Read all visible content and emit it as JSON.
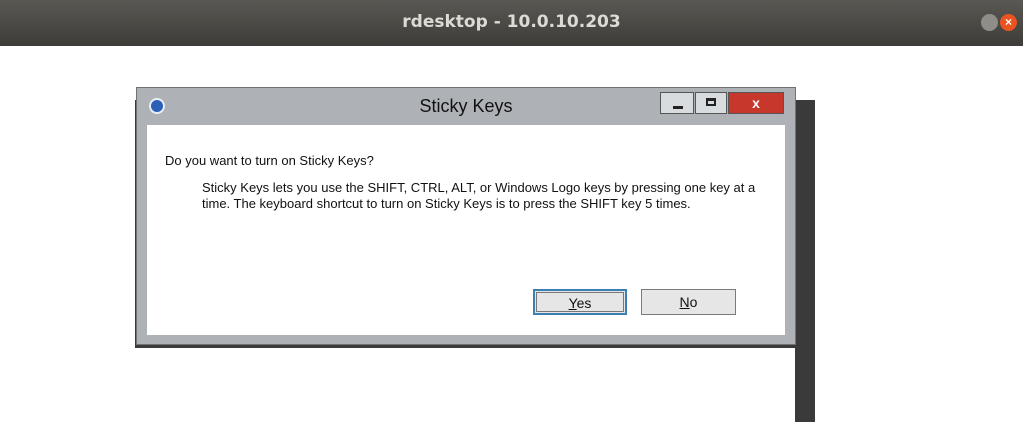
{
  "window": {
    "title": "rdesktop - 10.0.10.203",
    "close_glyph": "×"
  },
  "dialog": {
    "title": "Sticky Keys",
    "close_glyph": "x",
    "question": "Do you want to turn on Sticky Keys?",
    "description": "Sticky Keys lets you use the SHIFT, CTRL, ALT, or Windows Logo keys by pressing one key at a time. The keyboard shortcut to turn on Sticky Keys is to press the SHIFT key 5 times.",
    "yes_label_accel": "Y",
    "yes_label_rest": "es",
    "no_label_accel": "N",
    "no_label_rest": "o"
  },
  "colors": {
    "titlebar": "#3d3c38",
    "close_accent": "#e95420",
    "dialog_close": "#c7372b",
    "dialog_frame": "#aeb2b6",
    "background_shape": "#3a3a3a"
  }
}
